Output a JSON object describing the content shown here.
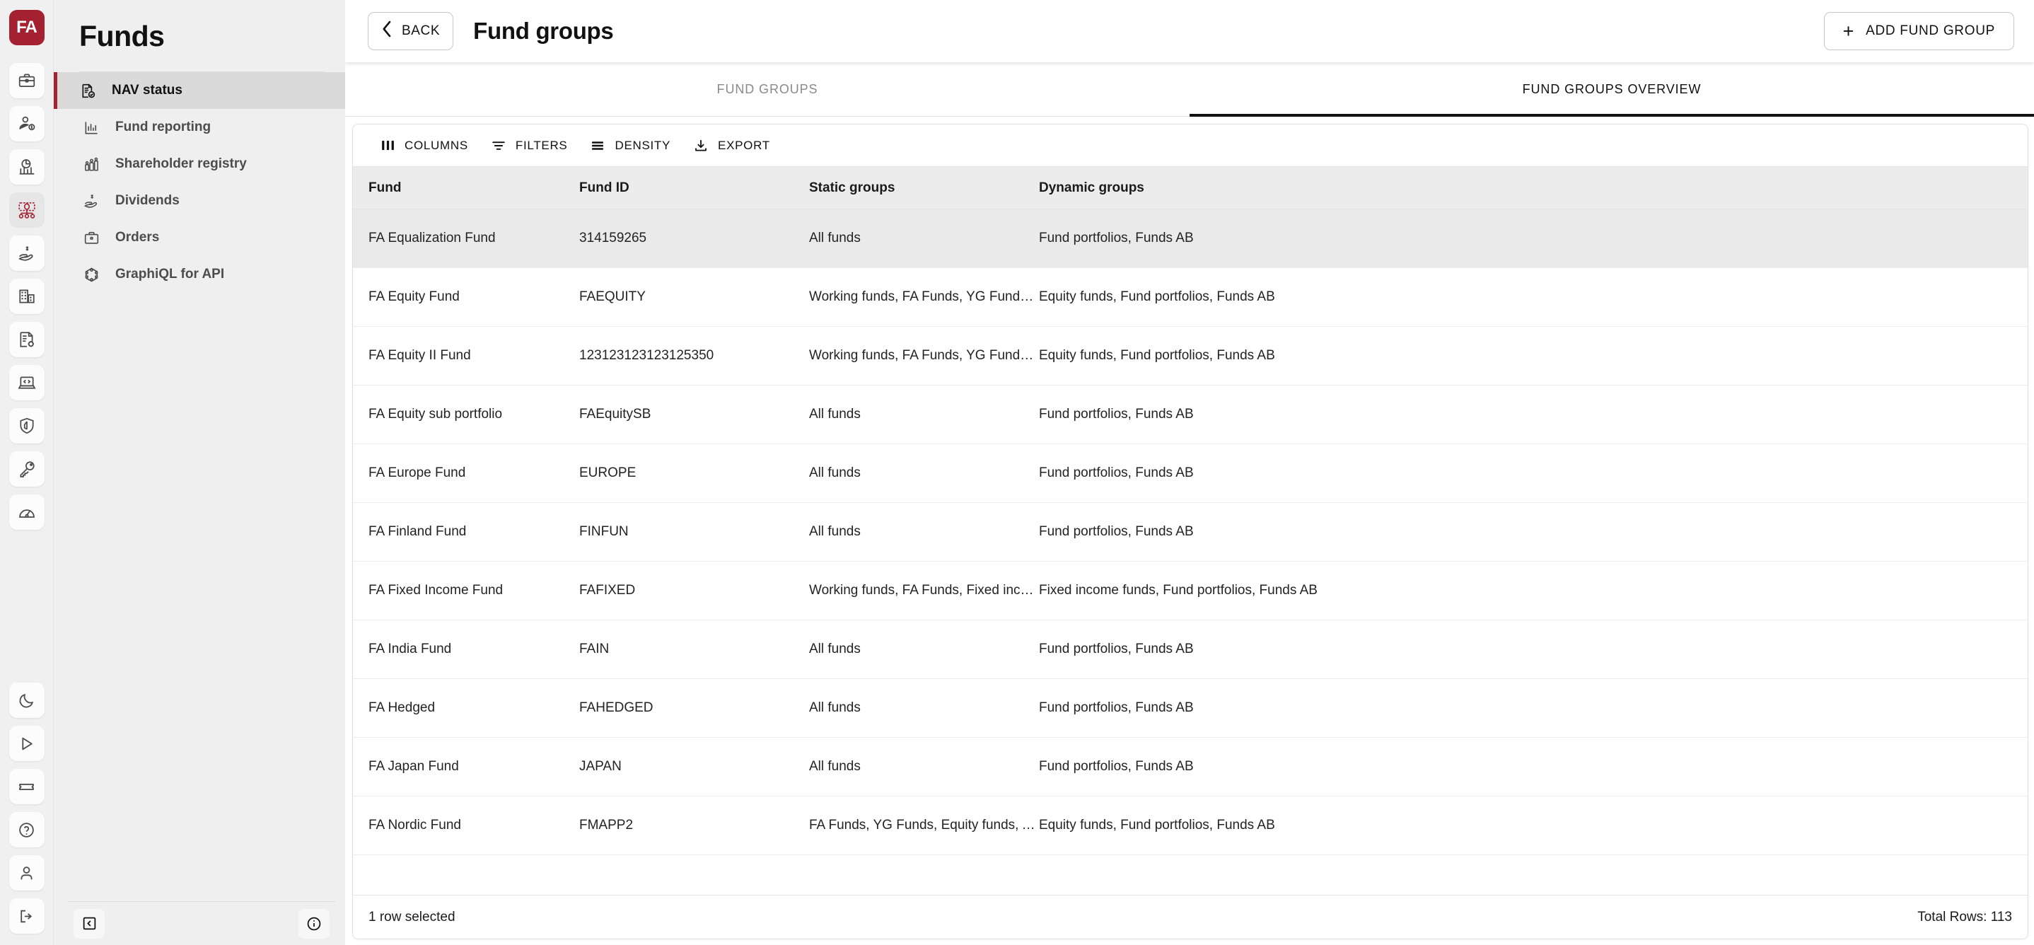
{
  "rail": {
    "logo_text": "FA",
    "top_icons": [
      {
        "name": "briefcase-icon"
      },
      {
        "name": "shareholder-icon"
      },
      {
        "name": "pie-chart-icon"
      },
      {
        "name": "fund-distribution-icon",
        "active": true
      },
      {
        "name": "dividends-hand-icon"
      },
      {
        "name": "building-icon"
      },
      {
        "name": "document-settings-icon"
      },
      {
        "name": "code-laptop-icon"
      },
      {
        "name": "shield-icon"
      },
      {
        "name": "key-icon"
      },
      {
        "name": "gauge-icon"
      }
    ],
    "bottom_icons": [
      {
        "name": "moon-icon"
      },
      {
        "name": "play-icon"
      },
      {
        "name": "ticket-icon"
      },
      {
        "name": "help-icon"
      },
      {
        "name": "user-icon"
      },
      {
        "name": "logout-icon"
      }
    ]
  },
  "sidebar": {
    "title": "Funds",
    "items": [
      {
        "label": "NAV status",
        "icon": "nav-status-icon",
        "active": true
      },
      {
        "label": "Fund reporting",
        "icon": "bar-chart-icon",
        "active": false
      },
      {
        "label": "Shareholder registry",
        "icon": "registry-icon",
        "active": false
      },
      {
        "label": "Dividends",
        "icon": "dividends-icon",
        "active": false
      },
      {
        "label": "Orders",
        "icon": "orders-icon",
        "active": false
      },
      {
        "label": "GraphiQL for API",
        "icon": "graphiql-icon",
        "active": false
      }
    ],
    "collapse_icon": "collapse-sidebar-icon",
    "info_icon": "info-icon"
  },
  "topbar": {
    "back_label": "BACK",
    "back_icon": "chevron-left-icon",
    "title": "Fund groups",
    "add_label": "ADD FUND GROUP",
    "add_icon": "plus-icon"
  },
  "tabs": [
    {
      "label": "FUND GROUPS",
      "active": false
    },
    {
      "label": "FUND GROUPS OVERVIEW",
      "active": true
    }
  ],
  "toolbar": [
    {
      "label": "COLUMNS",
      "icon": "columns-icon"
    },
    {
      "label": "FILTERS",
      "icon": "filter-icon"
    },
    {
      "label": "DENSITY",
      "icon": "density-icon"
    },
    {
      "label": "EXPORT",
      "icon": "export-icon"
    }
  ],
  "table": {
    "columns": [
      "Fund",
      "Fund ID",
      "Static groups",
      "Dynamic groups"
    ],
    "rows": [
      {
        "fund": "FA Equalization Fund",
        "fund_id": "314159265",
        "static_groups": "All funds",
        "dynamic_groups": "Fund portfolios, Funds AB",
        "selected": true
      },
      {
        "fund": "FA Equity Fund",
        "fund_id": "FAEQUITY",
        "static_groups": "Working funds, FA Funds, YG Funds, Equity funds, Al...",
        "dynamic_groups": "Equity funds, Fund portfolios, Funds AB",
        "selected": false
      },
      {
        "fund": "FA Equity II Fund",
        "fund_id": "123123123123125350",
        "static_groups": "Working funds, FA Funds, YG Funds, Equity funds, Al...",
        "dynamic_groups": "Equity funds, Fund portfolios, Funds AB",
        "selected": false
      },
      {
        "fund": "FA Equity sub portfolio",
        "fund_id": "FAEquitySB",
        "static_groups": "All funds",
        "dynamic_groups": "Fund portfolios, Funds AB",
        "selected": false
      },
      {
        "fund": "FA Europe Fund",
        "fund_id": "EUROPE",
        "static_groups": "All funds",
        "dynamic_groups": "Fund portfolios, Funds AB",
        "selected": false
      },
      {
        "fund": "FA Finland Fund",
        "fund_id": "FINFUN",
        "static_groups": "All funds",
        "dynamic_groups": "Fund portfolios, Funds AB",
        "selected": false
      },
      {
        "fund": "FA Fixed Income Fund",
        "fund_id": "FAFIXED",
        "static_groups": "Working funds, FA Funds, Fixed income funds, All fu...",
        "dynamic_groups": "Fixed income funds, Fund portfolios, Funds AB",
        "selected": false
      },
      {
        "fund": "FA India Fund",
        "fund_id": "FAIN",
        "static_groups": "All funds",
        "dynamic_groups": "Fund portfolios, Funds AB",
        "selected": false
      },
      {
        "fund": "FA Hedged",
        "fund_id": "FAHEDGED",
        "static_groups": "All funds",
        "dynamic_groups": "Fund portfolios, Funds AB",
        "selected": false
      },
      {
        "fund": "FA Japan Fund",
        "fund_id": "JAPAN",
        "static_groups": "All funds",
        "dynamic_groups": "Fund portfolios, Funds AB",
        "selected": false
      },
      {
        "fund": "FA Nordic Fund",
        "fund_id": "FMAPP2",
        "static_groups": "FA Funds, YG Funds, Equity funds, All funds",
        "dynamic_groups": "Equity funds, Fund portfolios, Funds AB",
        "selected": false
      }
    ],
    "footer": {
      "selection_text": "1 row selected",
      "total_text": "Total Rows: 113"
    }
  },
  "colors": {
    "brand_red": "#a42131",
    "accent_black": "#111111",
    "sidebar_bg": "#efefef",
    "rail_bg": "#f0f0f0",
    "selected_row": "#eaeaea",
    "header_row": "#ececec"
  }
}
